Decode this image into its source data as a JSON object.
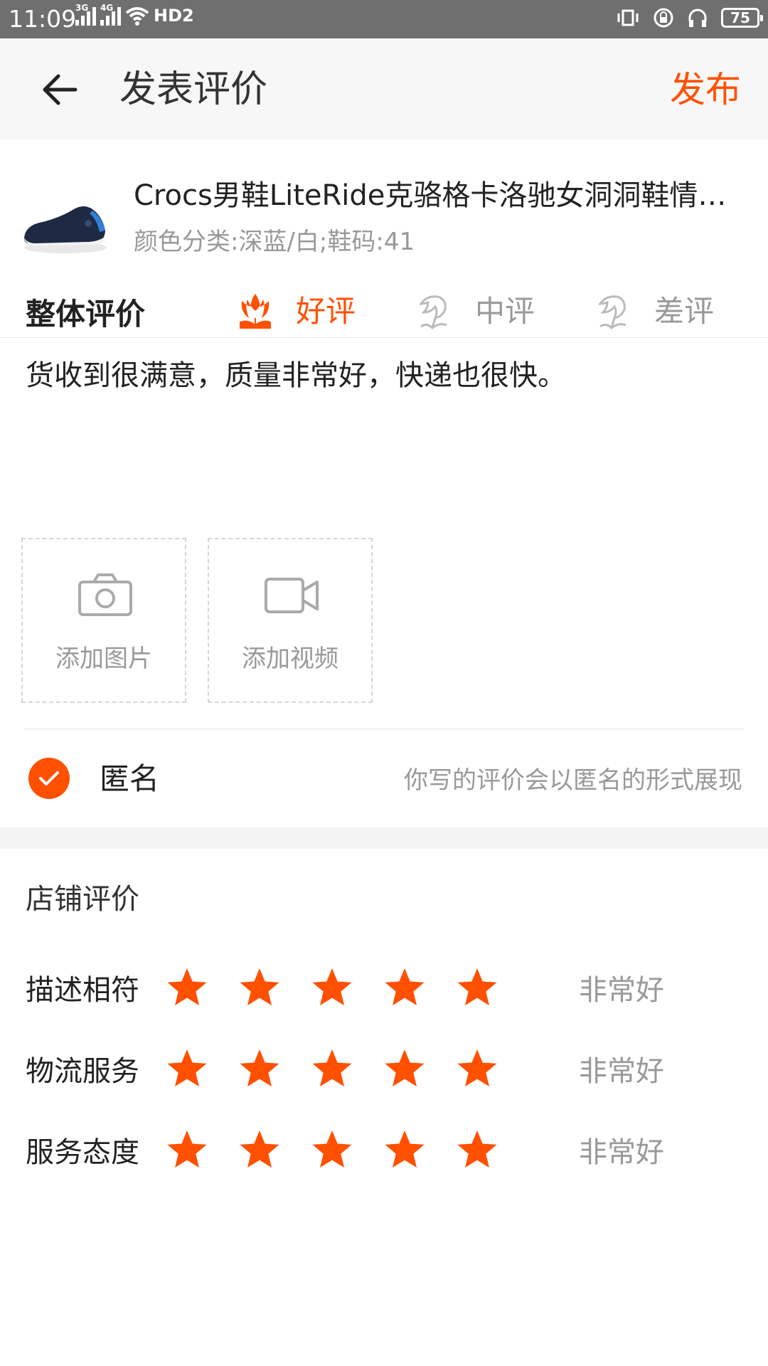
{
  "status_bar": {
    "time": "11:09",
    "network1": "3G",
    "network2": "4G",
    "hd": "HD2",
    "battery": "75"
  },
  "app_bar": {
    "title": "发表评价",
    "publish_label": "发布"
  },
  "product": {
    "name": "Crocs男鞋LiteRide克骆格卡洛驰女洞洞鞋情侣...",
    "attributes": "颜色分类:深蓝/白;鞋码:41"
  },
  "overall": {
    "label": "整体评价",
    "options": [
      {
        "label": "好评",
        "selected": true
      },
      {
        "label": "中评",
        "selected": false
      },
      {
        "label": "差评",
        "selected": false
      }
    ]
  },
  "review": {
    "text": "货收到很满意，质量非常好，快递也很快。"
  },
  "media": {
    "add_photo": "添加图片",
    "add_video": "添加视频"
  },
  "anonymous": {
    "label": "匿名",
    "hint": "你写的评价会以匿名的形式展现",
    "checked": true
  },
  "shop_rating": {
    "title": "店铺评价",
    "rows": [
      {
        "label": "描述相符",
        "stars": 5,
        "max": 5,
        "text": "非常好"
      },
      {
        "label": "物流服务",
        "stars": 5,
        "max": 5,
        "text": "非常好"
      },
      {
        "label": "服务态度",
        "stars": 5,
        "max": 5,
        "text": "非常好"
      }
    ]
  },
  "colors": {
    "accent": "#ff5000",
    "status_bar": "#6f6f6f",
    "muted_text": "#999999"
  }
}
